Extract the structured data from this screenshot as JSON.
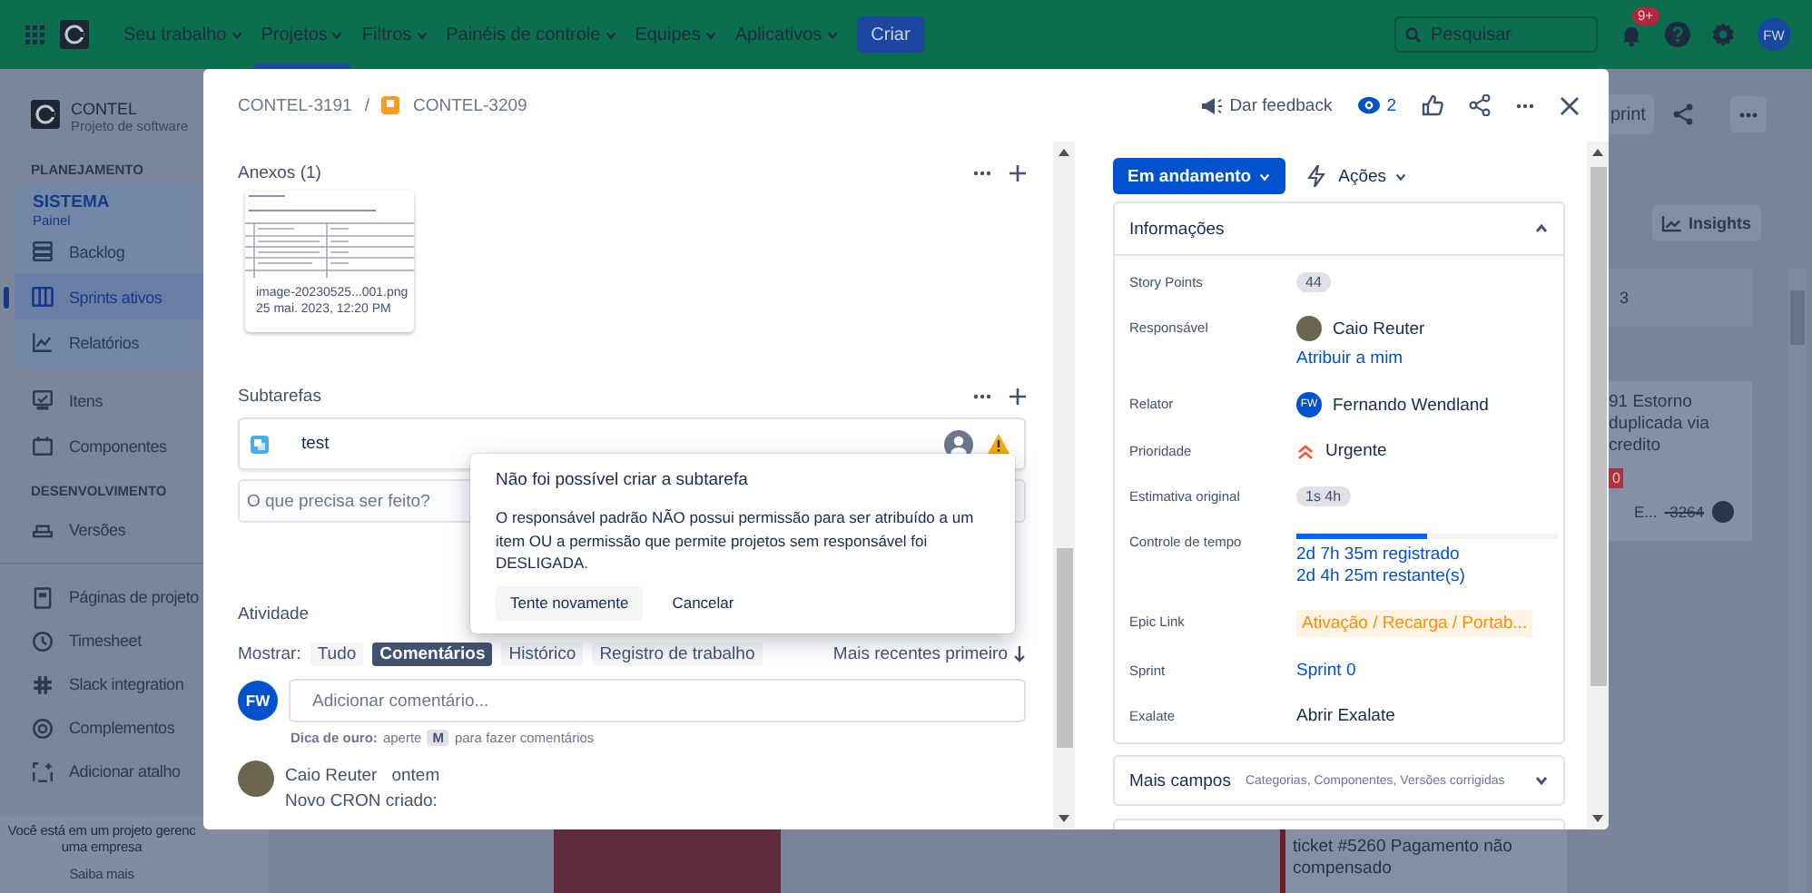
{
  "top_nav": {
    "menu": [
      {
        "label": "Seu trabalho",
        "selected": false
      },
      {
        "label": "Projetos",
        "selected": true
      },
      {
        "label": "Filtros",
        "selected": false
      },
      {
        "label": "Painéis de controle",
        "selected": false
      },
      {
        "label": "Equipes",
        "selected": false
      },
      {
        "label": "Aplicativos",
        "selected": false
      }
    ],
    "create_button": "Criar",
    "search_placeholder": "Pesquisar",
    "notification_badge": "9+",
    "user_initials": "FW"
  },
  "sidebar": {
    "project_name": "CONTEL",
    "project_type": "Projeto de software",
    "planning_heading": "PLANEJAMENTO",
    "board_title": "SISTEMA",
    "board_subtitle": "Painel",
    "board_items": [
      {
        "label": "Backlog",
        "selected": false
      },
      {
        "label": "Sprints ativos",
        "selected": true
      },
      {
        "label": "Relatórios",
        "selected": false
      }
    ],
    "items": [
      {
        "label": "Itens",
        "selected": false
      },
      {
        "label": "Componentes",
        "selected": false
      }
    ],
    "development_heading": "DESENVOLVIMENTO",
    "development_items": [
      {
        "label": "Versões",
        "selected": false
      }
    ],
    "shortcuts": [
      {
        "label": "Páginas de projeto",
        "selected": false
      },
      {
        "label": "Timesheet",
        "selected": false
      },
      {
        "label": "Slack integration",
        "selected": false
      },
      {
        "label": "Complementos",
        "selected": false
      },
      {
        "label": "Adicionar atalho",
        "selected": false
      }
    ],
    "footer_note_lines": [
      "Você está em um projeto gerenc",
      "uma empresa"
    ],
    "footer_link": "Saiba mais"
  },
  "board": {
    "sprint_button": "print",
    "insights_button": "Insights",
    "column_count": "3",
    "card": {
      "title_lines": [
        "91 Estorno",
        "duplicada via",
        "credito"
      ],
      "badge": "0",
      "epic": "E...",
      "key": "-3264"
    },
    "ticket_card": "ticket #5260 Pagamento não compensado"
  },
  "issue": {
    "breadcrumb": [
      "CONTEL-3191",
      "CONTEL-3209"
    ],
    "breadcrumb_separator": "/",
    "feedback_button": "Dar feedback",
    "watchers": "2",
    "attachments": {
      "heading": "Anexos (1)",
      "files": [
        {
          "name": "image-20230525...001.png",
          "date": "25 mai. 2023, 12:20 PM"
        }
      ]
    },
    "subtasks": {
      "heading": "Subtarefas",
      "items": [
        {
          "summary": "test",
          "warning": true
        }
      ],
      "new_placeholder": "O que precisa ser feito?"
    },
    "error_popup": {
      "title": "Não foi possível criar a subtarefa",
      "message": "O responsável padrão NÃO possui permissão para ser atribuído a um item OU a permissão que permite projetos sem responsável foi DESLIGADA.",
      "buttons": [
        "Tente novamente",
        "Cancelar"
      ]
    },
    "activity": {
      "heading": "Atividade",
      "show_label": "Mostrar:",
      "filters": [
        {
          "label": "Tudo",
          "selected": false
        },
        {
          "label": "Comentários",
          "selected": true
        },
        {
          "label": "Histórico",
          "selected": false
        },
        {
          "label": "Registro de trabalho",
          "selected": false
        }
      ],
      "sort": "Mais recentes primeiro",
      "user_initials": "FW",
      "comment_placeholder": "Adicionar comentário...",
      "tip_label": "Dica de ouro:",
      "tip_before": "aperte",
      "tip_key": "M",
      "tip_after": "para fazer comentários",
      "comments": [
        {
          "author": "Caio Reuter",
          "time": "ontem",
          "body": "Novo CRON criado:"
        }
      ]
    },
    "status_button": "Em andamento",
    "actions_button": "Ações",
    "details": {
      "title": "Informações",
      "expanded": true,
      "fields": [
        {
          "kind": "badge",
          "label": "Story Points",
          "value": "44"
        },
        {
          "kind": "user",
          "label": "Responsável",
          "value": "Caio Reuter",
          "link": "Atribuir a mim"
        },
        {
          "kind": "user",
          "label": "Relator",
          "value": "Fernando Wendland",
          "initials": "FW"
        },
        {
          "kind": "priority",
          "label": "Prioridade",
          "value": "Urgente"
        },
        {
          "kind": "badge",
          "label": "Estimativa original",
          "value": "1s 4h"
        },
        {
          "kind": "time",
          "label": "Controle de tempo",
          "level": 0.5,
          "logged": "2d 7h 35m registrado",
          "remaining": "2d 4h 25m restante(s)"
        },
        {
          "kind": "epic",
          "label": "Epic Link",
          "value": "Ativação / Recarga / Portab..."
        },
        {
          "kind": "link",
          "label": "Sprint",
          "value": "Sprint 0"
        },
        {
          "kind": "text",
          "label": "Exalate",
          "value": "Abrir Exalate"
        }
      ]
    },
    "more_fields": {
      "title": "Mais campos",
      "summary": "Categorias, Componentes, Versões corrigidas",
      "expanded": false
    }
  }
}
